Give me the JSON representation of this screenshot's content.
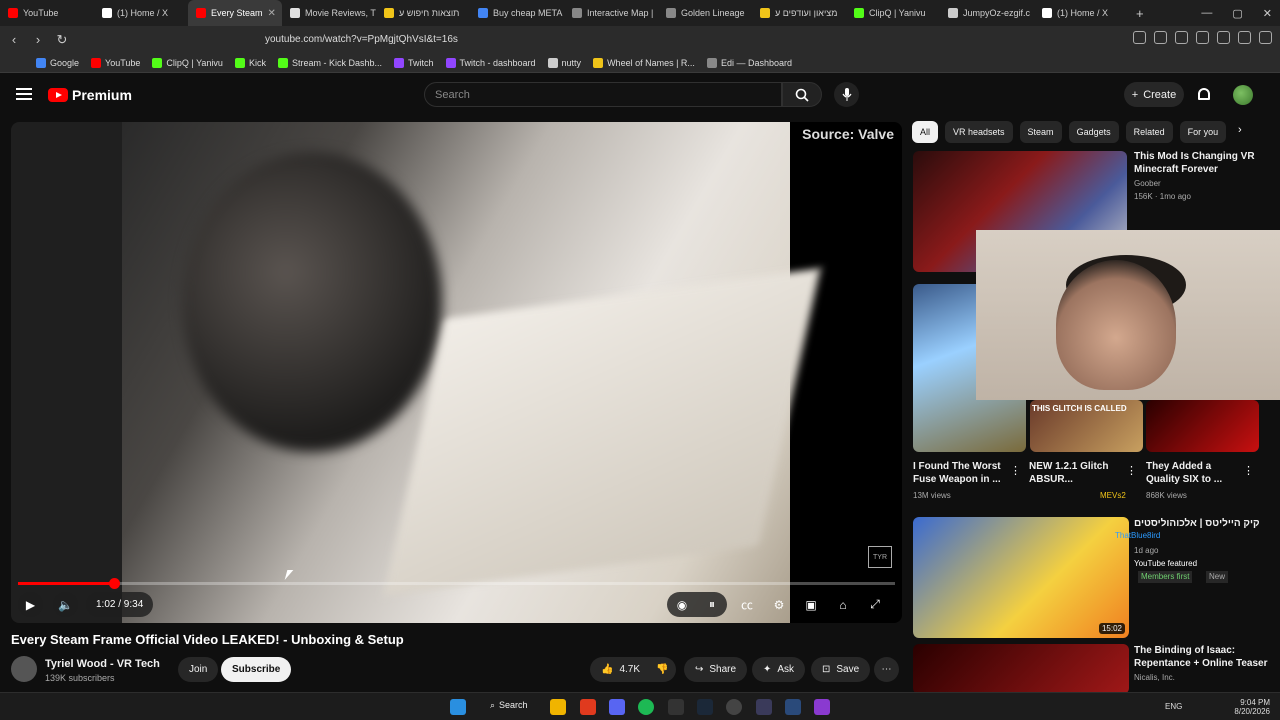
{
  "browser": {
    "tabs": [
      {
        "label": "YouTube",
        "color": "#ff0000"
      },
      {
        "label": "(1) Home / X",
        "color": "#ffffff"
      },
      {
        "label": "Every Steam",
        "color": "#ff0000"
      },
      {
        "label": "Movie Reviews, T",
        "color": "#e0e0e0"
      },
      {
        "label": "תוצאות חיפוש ע",
        "color": "#f0c419"
      },
      {
        "label": "Buy cheap META",
        "color": "#4285f4"
      },
      {
        "label": "Interactive Map |",
        "color": "#888888"
      },
      {
        "label": "Golden Lineage",
        "color": "#888888"
      },
      {
        "label": "מציאון ועודפים ע",
        "color": "#f0c419"
      },
      {
        "label": "ClipQ | Yanivu",
        "color": "#53fc18"
      },
      {
        "label": "JumpyOz-ezgif.c",
        "color": "#cccccc"
      },
      {
        "label": "(1) Home / X",
        "color": "#ffffff"
      }
    ],
    "url": "youtube.com/watch?v=PpMgjtQhVsI&t=16s",
    "bookmarks": [
      "Google",
      "YouTube",
      "ClipQ | Yanivu",
      "Kick",
      "Stream - Kick Dashb...",
      "Twitch",
      "Twitch - dashboard",
      "nutty",
      "Wheel of Names | R...",
      "Edi — Dashboard"
    ]
  },
  "masthead": {
    "logo_text": "Premium",
    "search_placeholder": "Search",
    "create_label": "Create"
  },
  "player": {
    "source_overlay": "Source: Valve",
    "watermark": "TYR",
    "time": "1:02 / 9:34",
    "progress": 0.109
  },
  "video": {
    "title": "Every Steam Frame Official Video LEAKED! - Unboxing & Setup",
    "channel": "Tyriel Wood - VR Tech",
    "subscribers": "139K subscribers",
    "join_label": "Join",
    "subscribe_label": "Subscribe",
    "likes": "4.7K",
    "share_label": "Share",
    "ask_label": "Ask",
    "save_label": "Save"
  },
  "chips": [
    "All",
    "VR headsets",
    "Steam",
    "Gadgets",
    "Related",
    "For you"
  ],
  "recommendations": [
    {
      "title": "This Mod Is Changing VR Minecraft Forever",
      "channel": "Goober",
      "meta": "156K · 1mo ago"
    },
    {
      "title": "I Found The Worst Fuse Weapon in ...",
      "meta": "13M views"
    },
    {
      "title": "NEW 1.2.1 Glitch ABSUR...",
      "meta": "MEVs2"
    },
    {
      "title": "They Added a Quality SIX to ...",
      "meta": "868K views"
    },
    {
      "title": "קיק הייליטס | אלכוהוליסטים",
      "channel": "1d ago",
      "meta": "YouTube featured",
      "extra": "Members first",
      "extra2": "New",
      "duration": "15:02"
    },
    {
      "title": "The Binding of Isaac: Repentance + Online Teaser",
      "channel": "Nicalis, Inc."
    }
  ],
  "overlay_texts": [
    "THIS GLITCH IS CALLED",
    "ThatBlue8ird"
  ],
  "taskbar": {
    "search_label": "Search",
    "lang": "ENG",
    "time": "9:04 PM",
    "date": "8/20/2026"
  }
}
